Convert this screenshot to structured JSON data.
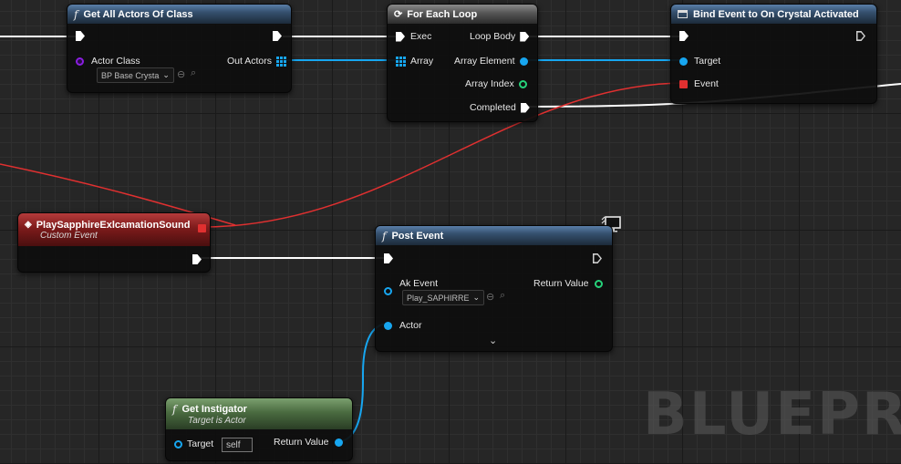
{
  "watermark": "BLUEPRI",
  "nodes": {
    "get_all_actors": {
      "title": "Get All Actors Of Class",
      "actor_class_label": "Actor Class",
      "actor_class_value": "BP Base Crysta",
      "out_actors_label": "Out Actors"
    },
    "for_each": {
      "title": "For Each Loop",
      "exec_label": "Exec",
      "array_label": "Array",
      "loop_body_label": "Loop Body",
      "array_element_label": "Array Element",
      "array_index_label": "Array Index",
      "completed_label": "Completed"
    },
    "bind_event": {
      "title": "Bind Event to On Crystal Activated",
      "target_label": "Target",
      "event_label": "Event"
    },
    "custom_event": {
      "title": "PlaySapphireExlcamationSound",
      "subtitle": "Custom Event"
    },
    "post_event": {
      "title": "Post Event",
      "ak_event_label": "Ak Event",
      "ak_event_value": "Play_SAPHIRRE",
      "return_value_label": "Return Value",
      "actor_label": "Actor"
    },
    "get_instigator": {
      "title": "Get Instigator",
      "subtitle": "Target is Actor",
      "target_label": "Target",
      "target_value": "self",
      "return_value_label": "Return Value"
    }
  },
  "colors": {
    "exec_wire": "#ffffff",
    "object_wire": "#17a6f0",
    "delegate_wire": "#e03030",
    "class_pin": "#8a1ee0",
    "int_pin": "#26d27a"
  }
}
